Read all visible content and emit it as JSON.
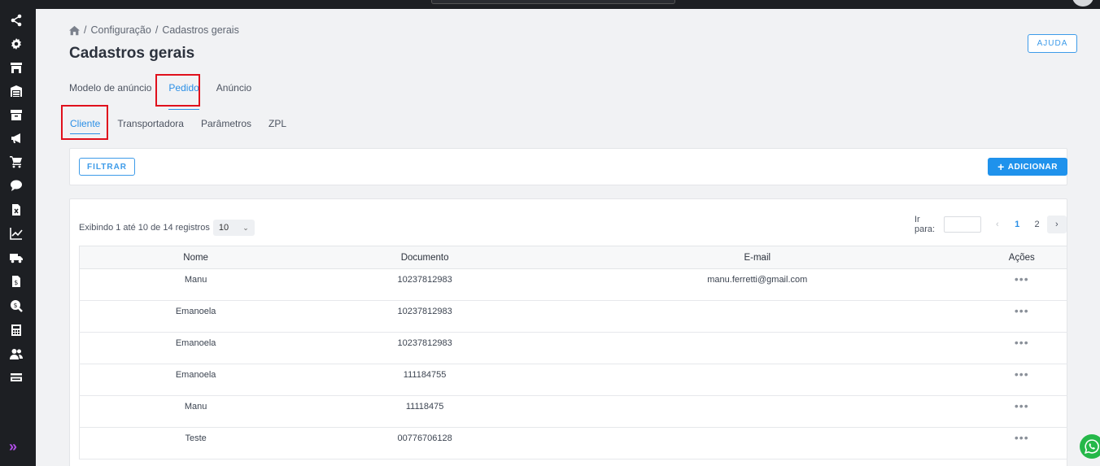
{
  "breadcrumb": {
    "items": [
      "Configuração",
      "Cadastros gerais"
    ]
  },
  "page": {
    "title": "Cadastros gerais",
    "help_label": "AJUDA"
  },
  "tabs_main": [
    {
      "label": "Modelo de anúncio"
    },
    {
      "label": "Pedido"
    },
    {
      "label": "Anúncio"
    }
  ],
  "tabs_sub": [
    {
      "label": "Cliente"
    },
    {
      "label": "Transportadora"
    },
    {
      "label": "Parâmetros"
    },
    {
      "label": "ZPL"
    }
  ],
  "toolbar": {
    "filter_label": "FILTRAR",
    "add_label": "ADICIONAR"
  },
  "listing": {
    "showing_text": "Exibindo 1 até 10 de 14 registros",
    "per_page": "10",
    "goto_label": "Ir para:",
    "pages": [
      "1",
      "2"
    ],
    "prev_symbol": "‹",
    "next_symbol": "›",
    "actions_symbol": "•••"
  },
  "table": {
    "columns": [
      "Nome",
      "Documento",
      "E-mail",
      "Ações"
    ],
    "rows": [
      {
        "nome": "Manu",
        "documento": "10237812983",
        "email": "manu.ferretti@gmail.com"
      },
      {
        "nome": "Emanoela",
        "documento": "10237812983",
        "email": ""
      },
      {
        "nome": "Emanoela",
        "documento": "10237812983",
        "email": ""
      },
      {
        "nome": "Emanoela",
        "documento": "111184755",
        "email": ""
      },
      {
        "nome": "Manu",
        "documento": "11118475",
        "email": ""
      },
      {
        "nome": "Teste",
        "documento": "00776706128",
        "email": ""
      }
    ]
  },
  "sidebar": {
    "icons": [
      "share-icon",
      "gear-icon",
      "store-icon",
      "warehouse-icon",
      "archive-icon",
      "megaphone-icon",
      "cart-icon",
      "chat-icon",
      "excel-file-icon",
      "chart-line-icon",
      "truck-icon",
      "invoice-icon",
      "search-dollar-icon",
      "calculator-icon",
      "users-icon",
      "card-icon"
    ],
    "expand_symbol": "»"
  },
  "colors": {
    "accent": "#1f92ec",
    "highlight": "#e0101c",
    "sidebar": "#1d1f23",
    "whatsapp": "#25b849"
  }
}
